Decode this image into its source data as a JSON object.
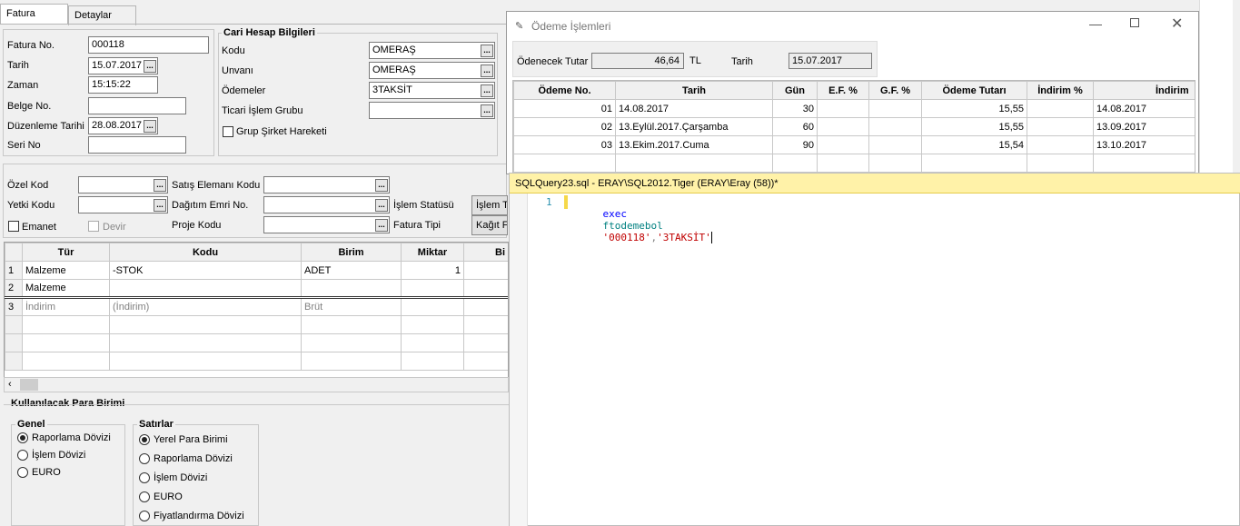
{
  "tabs": [
    "Fatura",
    "Detaylar"
  ],
  "invoice": {
    "fatura_no_label": "Fatura No.",
    "fatura_no": "000118",
    "tarih_label": "Tarih",
    "tarih": "15.07.2017",
    "zaman_label": "Zaman",
    "zaman": "15:15:22",
    "belge_no_label": "Belge No.",
    "belge_no": "",
    "duzenleme_label": "Düzenleme Tarihi",
    "duzenleme": "28.08.2017",
    "seri_no_label": "Seri No",
    "seri_no": ""
  },
  "cari": {
    "title": "Cari Hesap Bilgileri",
    "kodu_label": "Kodu",
    "kodu": "OMERAŞ",
    "unvani_label": "Unvanı",
    "unvani": "OMERAŞ",
    "odemeler_label": "Ödemeler",
    "odemeler": "3TAKSİT",
    "ticari_label": "Ticari İşlem Grubu",
    "ticari": "",
    "grup_label": "Grup Şirket Hareketi"
  },
  "mid": {
    "ozel_kod_label": "Özel Kod",
    "yetki_kodu_label": "Yetki Kodu",
    "satis_label": "Satış Elemanı Kodu",
    "dagitim_label": "Dağıtım Emri No.",
    "proje_label": "Proje Kodu",
    "islem_statusu_label": "İşlem Statüsü",
    "islem_statusu_value": "İşlem T",
    "fatura_tipi_label": "Fatura Tipi",
    "fatura_tipi_value": "Kağıt F",
    "emanet_label": "Emanet",
    "devir_label": "Devir"
  },
  "lines": {
    "headers": [
      "Tür",
      "Kodu",
      "Birim",
      "Miktar",
      "Bi"
    ],
    "rows": [
      {
        "n": "1",
        "tur": "Malzeme",
        "kodu": "-STOK",
        "birim": "ADET",
        "miktar": "1"
      },
      {
        "n": "2",
        "tur": "Malzeme",
        "kodu": "",
        "birim": "",
        "miktar": ""
      },
      {
        "n": "3",
        "tur": "İndirim",
        "kodu": "(İndirim)",
        "birim": "Brüt",
        "miktar": ""
      }
    ]
  },
  "currency": {
    "title": "Kullanılacak Para Birimi",
    "genel_title": "Genel",
    "genel_options": [
      "Raporlama Dövizi",
      "İşlem Dövizi",
      "EURO"
    ],
    "genel_selected": 0,
    "satirlar_title": "Satırlar",
    "satirlar_options": [
      "Yerel Para Birimi",
      "Raporlama Dövizi",
      "İşlem Dövizi",
      "EURO",
      "Fiyatlandırma Dövizi"
    ],
    "satirlar_selected": 0
  },
  "payment_window": {
    "title": "Ödeme İşlemleri",
    "odenecek_label": "Ödenecek Tutar",
    "odenecek": "46,64",
    "currency": "TL",
    "tarih_label": "Tarih",
    "tarih": "15.07.2017",
    "headers": [
      "Ödeme No.",
      "Tarih",
      "Gün",
      "E.F. %",
      "G.F. %",
      "Ödeme Tutarı",
      "İndirim %",
      "İndirim"
    ],
    "rows": [
      {
        "no": "01",
        "tarih": "14.08.2017",
        "gun": "30",
        "ef": "",
        "gf": "",
        "tutar": "15,55",
        "indirim_pct": "",
        "indirim": "14.08.2017"
      },
      {
        "no": "02",
        "tarih": "13.Eylül.2017.Çarşamba",
        "gun": "60",
        "ef": "",
        "gf": "",
        "tutar": "15,55",
        "indirim_pct": "",
        "indirim": "13.09.2017"
      },
      {
        "no": "03",
        "tarih": "13.Ekim.2017.Cuma",
        "gun": "90",
        "ef": "",
        "gf": "",
        "tutar": "15,54",
        "indirim_pct": "",
        "indirim": "13.10.2017"
      }
    ]
  },
  "sql_editor": {
    "title": "SQLQuery23.sql - ERAY\\SQL2012.Tiger (ERAY\\Eray (58))*",
    "line_no": "1",
    "keyword": "exec",
    "func": "ftodemebol",
    "arg1": "'000118'",
    "comma": ",",
    "arg2": "'3TAKSİT'"
  }
}
